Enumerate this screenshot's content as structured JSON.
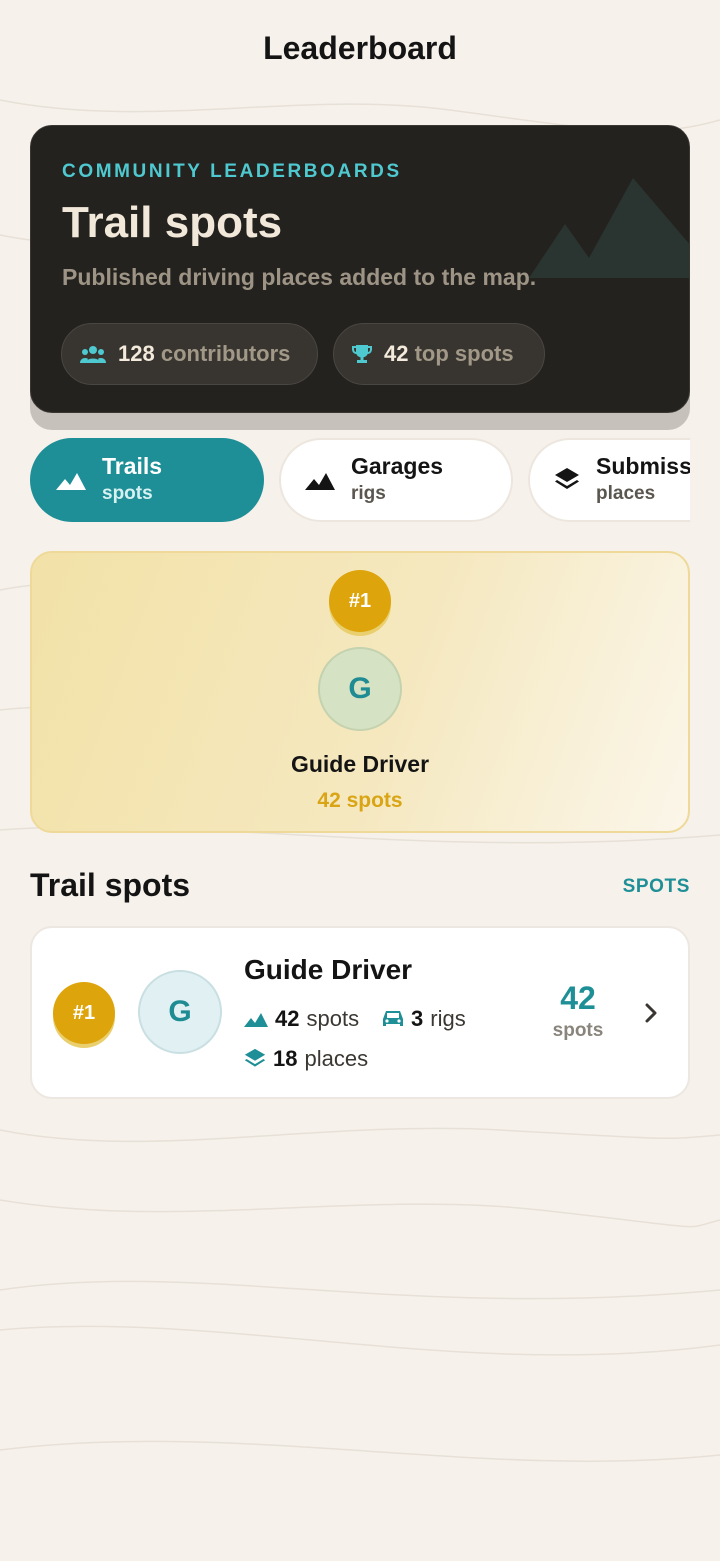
{
  "header": {
    "title": "Leaderboard"
  },
  "hero": {
    "kicker": "COMMUNITY LEADERBOARDS",
    "title": "Trail spots",
    "subtitle": "Published driving places added to the map.",
    "contributors": {
      "count": "128",
      "label": "contributors",
      "icon": "people-icon"
    },
    "top_spots": {
      "count": "42",
      "label": "top spots",
      "icon": "trophy-icon"
    }
  },
  "tabs": [
    {
      "title": "Trails",
      "subtitle": "spots",
      "icon": "mountain-icon",
      "active": true
    },
    {
      "title": "Garages",
      "subtitle": "rigs",
      "icon": "mountain-icon",
      "active": false
    },
    {
      "title": "Submiss",
      "subtitle": "places",
      "icon": "layers-icon",
      "active": false
    }
  ],
  "podium": {
    "rank": "#1",
    "initial": "G",
    "name": "Guide Driver",
    "score": "42 spots"
  },
  "section": {
    "title": "Trail spots",
    "link": "SPOTS"
  },
  "entries": [
    {
      "rank": "#1",
      "initial": "G",
      "name": "Guide Driver",
      "spots_value": "42",
      "spots_label": "spots",
      "rigs_value": "3",
      "rigs_label": "rigs",
      "places_value": "18",
      "places_label": "places",
      "score_value": "42",
      "score_label": "spots"
    }
  ],
  "colors": {
    "background": "#f6f1eb",
    "accent": "#1e8f96",
    "cyan": "#4fc9d0",
    "gold": "#dea40b",
    "hero_bg": "#24221f"
  }
}
